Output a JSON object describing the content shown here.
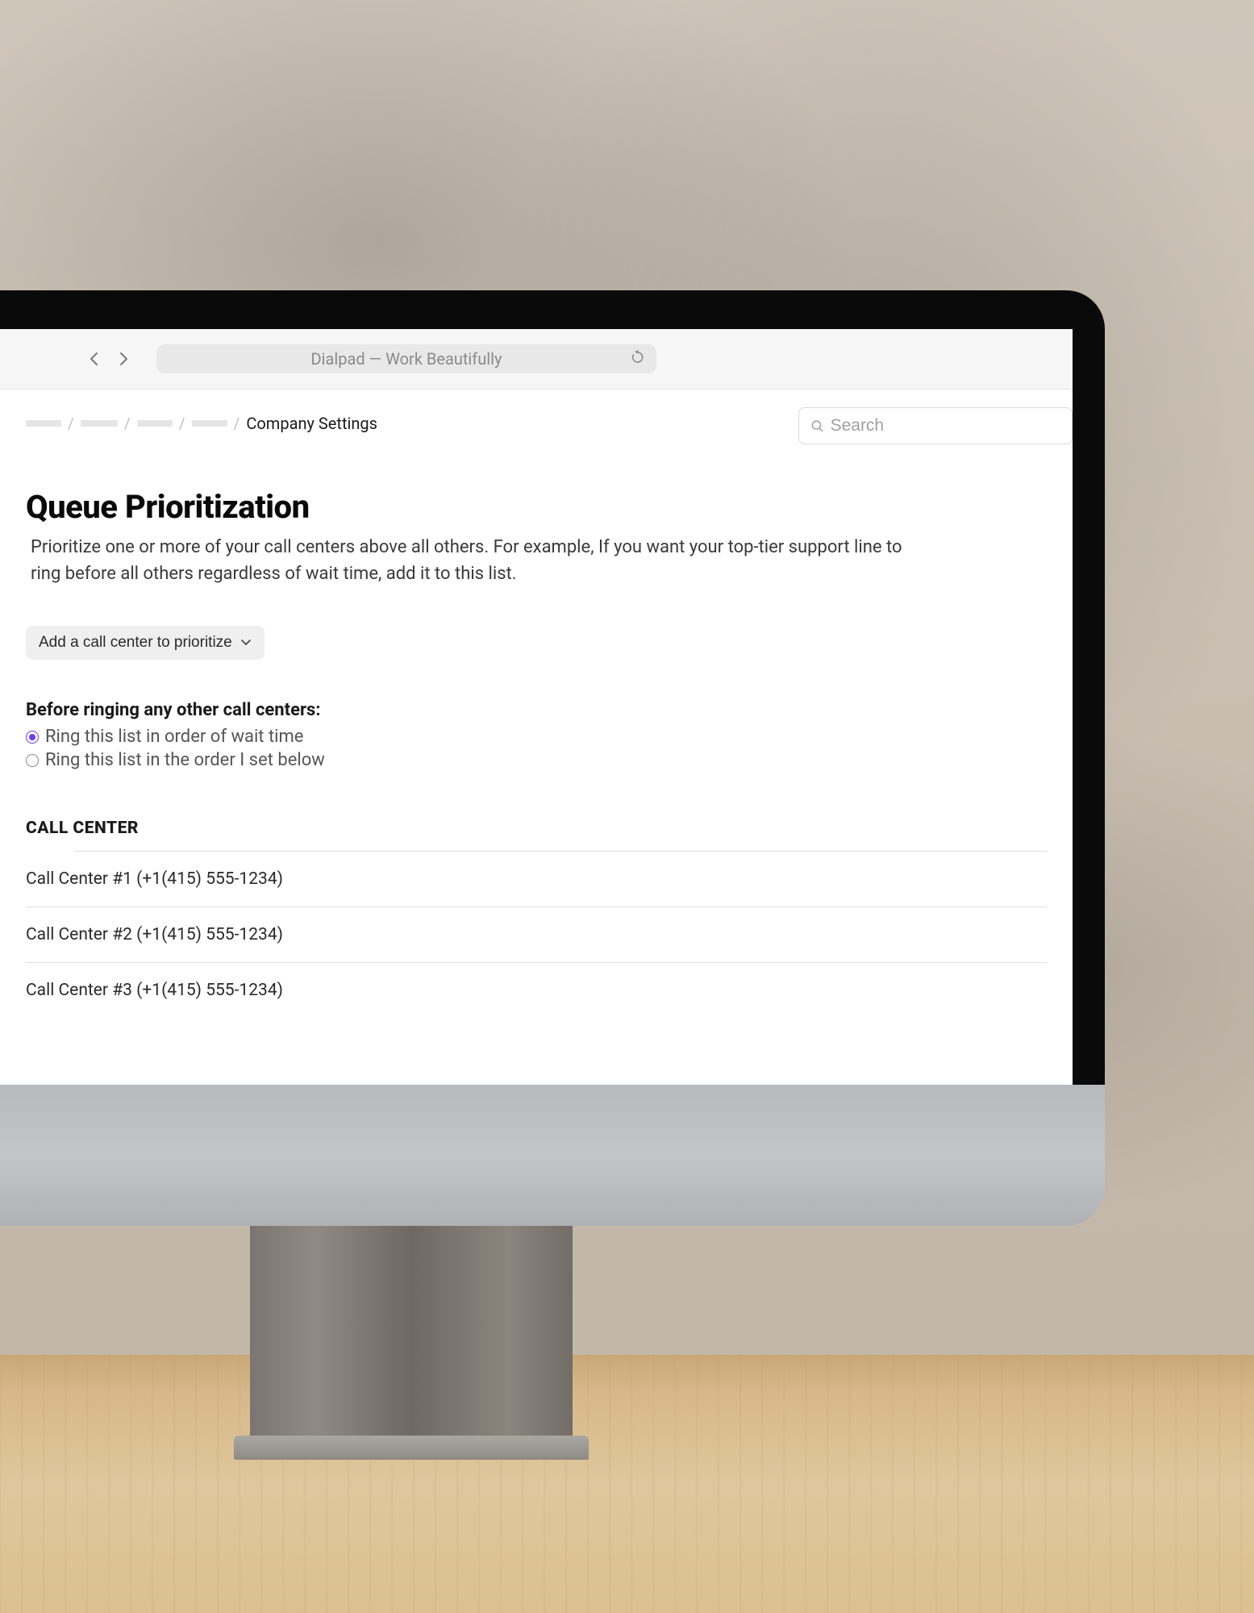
{
  "browser": {
    "title": "Dialpad — Work Beautifully"
  },
  "breadcrumbs": {
    "current": "Company Settings"
  },
  "search": {
    "placeholder": "Search"
  },
  "page": {
    "title": "Queue Prioritization",
    "description": "Prioritize one or more of your call centers above all others. For example, If you want your top-tier support line to ring before all others regardless of wait time, add it to this list."
  },
  "dropdown": {
    "label": "Add a call center to prioritize"
  },
  "radio_section": {
    "heading": "Before ringing any other call centers:",
    "options": [
      {
        "label": "Ring this list in order of wait time",
        "checked": true
      },
      {
        "label": "Ring this list in the order I set below",
        "checked": false
      }
    ]
  },
  "table": {
    "header": "CALL CENTER",
    "rows": [
      "Call Center #1 (+1(415) 555-1234)",
      "Call Center #2 (+1(415) 555-1234)",
      "Call Center #3 (+1(415) 555-1234)"
    ]
  }
}
